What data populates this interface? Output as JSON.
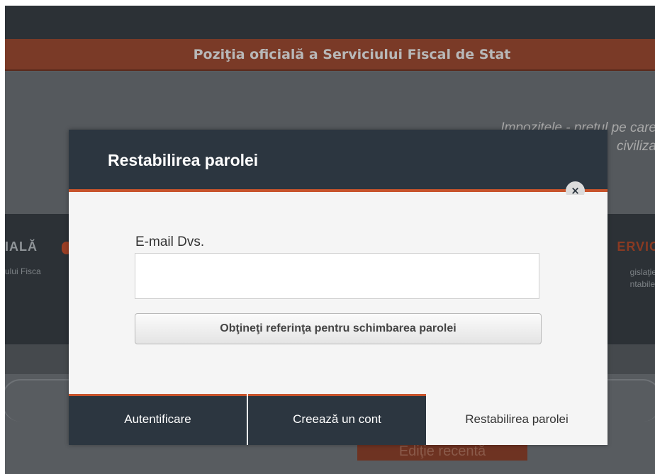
{
  "background": {
    "banner_text": "Poziţia oficială a Serviciului Fiscal de Stat",
    "quote_line1": "Impozitele - preţul pe care",
    "quote_line2": "civiliza",
    "nav_left_title": "IALĂ",
    "nav_left_sub": "ului Fisca",
    "nav_right_title": "ERVIC",
    "nav_right_sub1": "gislaţie",
    "nav_right_sub2": "ntabile",
    "bottom_button": "Ediţie recentă"
  },
  "modal": {
    "title": "Restabilirea parolei",
    "close_glyph": "×",
    "email_label": "E-mail Dvs.",
    "email_value": "",
    "email_placeholder": "",
    "reset_button_label": "Obţineţi referinţa pentru schimbarea parolei",
    "tabs": [
      {
        "label": "Autentificare"
      },
      {
        "label": "Creează un cont"
      },
      {
        "label": "Restabilirea parolei"
      }
    ]
  },
  "colors": {
    "accent": "#c8542c",
    "header_dark": "#2c3640",
    "overlay": "#585c60"
  }
}
